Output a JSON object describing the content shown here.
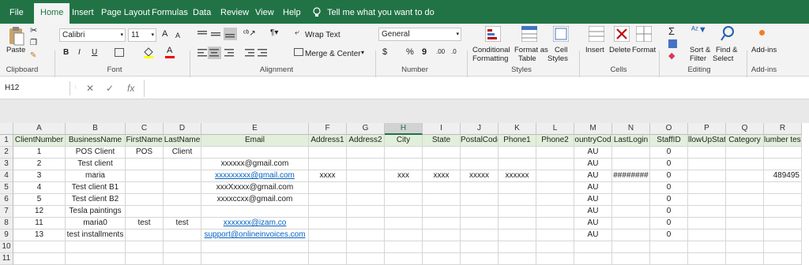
{
  "tabs": [
    "File",
    "Home",
    "Insert",
    "Page Layout",
    "Formulas",
    "Data",
    "Review",
    "View",
    "Help"
  ],
  "tell_me": "Tell me what you want to do",
  "ribbon": {
    "clipboard": {
      "paste": "Paste",
      "label": "Clipboard"
    },
    "font": {
      "name": "Calibri",
      "size": "11",
      "bold": "B",
      "italic": "I",
      "underline": "U",
      "grow": "A",
      "shrink": "A",
      "color_a": "A",
      "label": "Font"
    },
    "alignment": {
      "wrap": "Wrap Text",
      "merge": "Merge & Center",
      "label": "Alignment"
    },
    "number": {
      "format": "General",
      "currency": "$",
      "percent": "%",
      "comma": "9",
      "inc": ".00",
      "dec": ".0",
      "label": "Number"
    },
    "styles": {
      "conditional": "Conditional",
      "formatting": "Formatting",
      "format_as": "Format as",
      "table": "Table",
      "cell": "Cell",
      "styles_btn": "Styles",
      "label": "Styles"
    },
    "cells": {
      "insert": "Insert",
      "delete": "Delete",
      "format": "Format",
      "label": "Cells"
    },
    "editing": {
      "sort": "Sort &",
      "filter": "Filter",
      "find": "Find &",
      "select": "Select",
      "label": "Editing"
    },
    "addins": {
      "btn": "Add-ins",
      "label": "Add-ins"
    }
  },
  "formula_bar": {
    "name_box": "H12",
    "fx": "fx",
    "x": "✕",
    "check": "✓",
    "content": ""
  },
  "sheet": {
    "columns": [
      "A",
      "B",
      "C",
      "D",
      "E",
      "F",
      "G",
      "H",
      "I",
      "J",
      "K",
      "L",
      "M",
      "N",
      "O",
      "P",
      "Q",
      "R"
    ],
    "selected_column": "H",
    "row_numbers": [
      "1",
      "2",
      "3",
      "4",
      "5",
      "6",
      "7",
      "8",
      "9",
      "10",
      "11"
    ],
    "rows": [
      [
        "ClientNumber",
        "BusinessName",
        "FirstName",
        "LastName",
        "Email",
        "Address1",
        "Address2",
        "City",
        "State",
        "PostalCode",
        "Phone1",
        "Phone2",
        "ountryCod",
        "LastLogin",
        "StaffID",
        "llowUpStat",
        "Category",
        "lumber test"
      ],
      [
        "1",
        "POS Client",
        "POS",
        "Client",
        "",
        "",
        "",
        "",
        "",
        "",
        "",
        "",
        "AU",
        "",
        "0",
        "",
        "",
        ""
      ],
      [
        "2",
        "Test client",
        "",
        "",
        "xxxxxx@gmail.com",
        "",
        "",
        "",
        "",
        "",
        "",
        "",
        "AU",
        "",
        "0",
        "",
        "",
        ""
      ],
      [
        "3",
        "maria",
        "",
        "",
        "xxxxxxxxx@gmail.com",
        "xxxx",
        "",
        "xxx",
        "xxxx",
        "xxxxx",
        "xxxxxx",
        "",
        "AU",
        "########",
        "0",
        "",
        "",
        "489495"
      ],
      [
        "4",
        "Test client B1",
        "",
        "",
        "xxxXxxxx@gmail.com",
        "",
        "",
        "",
        "",
        "",
        "",
        "",
        "AU",
        "",
        "0",
        "",
        "",
        ""
      ],
      [
        "5",
        "Test client B2",
        "",
        "",
        "xxxxccxx@gmail.com",
        "",
        "",
        "",
        "",
        "",
        "",
        "",
        "AU",
        "",
        "0",
        "",
        "",
        ""
      ],
      [
        "12",
        "Tesla paintings",
        "",
        "",
        "",
        "",
        "",
        "",
        "",
        "",
        "",
        "",
        "AU",
        "",
        "0",
        "",
        "",
        ""
      ],
      [
        "11",
        "maria0",
        "test",
        "test",
        "xxxxxxx@izam.co",
        "",
        "",
        "",
        "",
        "",
        "",
        "",
        "AU",
        "",
        "0",
        "",
        "",
        ""
      ],
      [
        "13",
        "test installments",
        "",
        "",
        "support@onlineinvoices.com",
        "",
        "",
        "",
        "",
        "",
        "",
        "",
        "AU",
        "",
        "0",
        "",
        "",
        ""
      ],
      [
        "",
        "",
        "",
        "",
        "",
        "",
        "",
        "",
        "",
        "",
        "",
        "",
        "",
        "",
        "",
        "",
        "",
        ""
      ],
      [
        "",
        "",
        "",
        "",
        "",
        "",
        "",
        "",
        "",
        "",
        "",
        "",
        "",
        "",
        "",
        "",
        "",
        ""
      ]
    ],
    "link_cells": [
      "3-4",
      "7-4",
      "8-4"
    ],
    "accent": "#217346",
    "header_fill": "#e2efda",
    "link_color": "#0563c1"
  }
}
